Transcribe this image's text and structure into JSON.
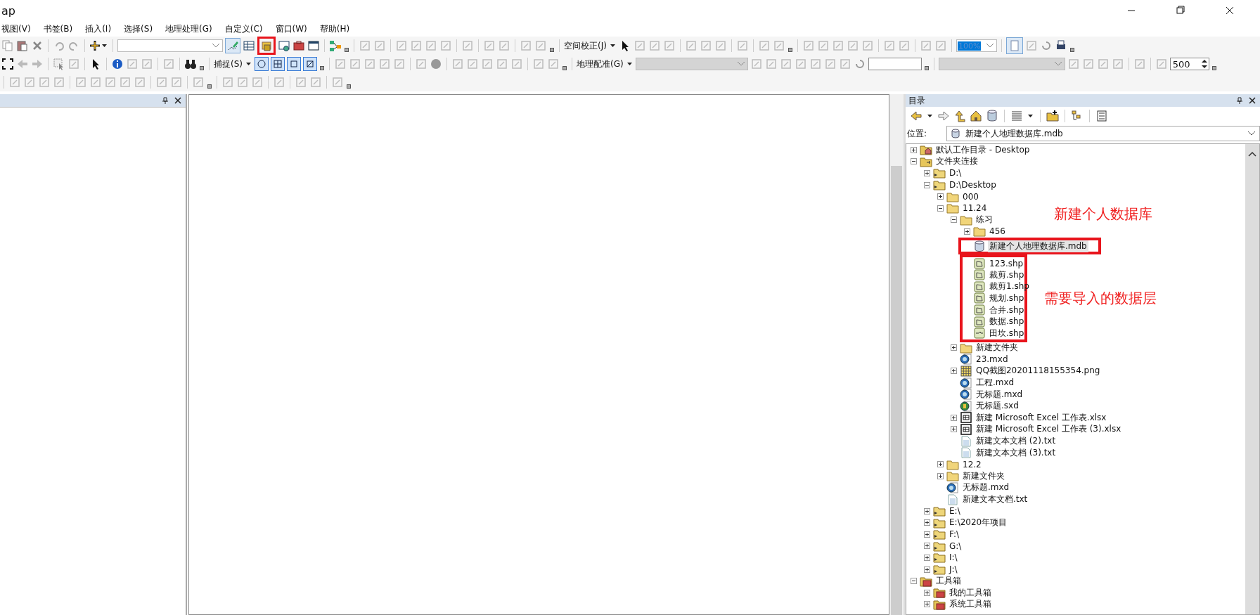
{
  "window": {
    "title": "ap"
  },
  "menu": [
    {
      "label": "视图(V)"
    },
    {
      "label": "书签(B)"
    },
    {
      "label": "插入(I)"
    },
    {
      "label": "选择(S)"
    },
    {
      "label": "地理处理(G)"
    },
    {
      "label": "自定义(C)"
    },
    {
      "label": "窗口(W)"
    },
    {
      "label": "帮助(H)"
    }
  ],
  "toolbars": {
    "catalog_button": {
      "highlighted": true
    },
    "spatial_adjustment": {
      "label": "空间校正(J)"
    },
    "layout_zoom": {
      "value": "100%"
    },
    "snapping": {
      "label": "捕捉(S)"
    },
    "georeferencing": {
      "label": "地理配准(G)"
    },
    "spinner": {
      "value": "500"
    }
  },
  "catalog": {
    "title": "目录",
    "location_label": "位置:",
    "location_value": "新建个人地理数据库.mdb",
    "tree": [
      {
        "label": "默认工作目录 - Desktop",
        "kind": "home-folder",
        "expanded": false,
        "selected": false
      },
      {
        "label": "文件夹连接",
        "kind": "connections",
        "expanded": true,
        "selected": false,
        "children": [
          {
            "label": "D:\\",
            "kind": "drive",
            "expanded": false,
            "selected": false
          },
          {
            "label": "D:\\Desktop",
            "kind": "drive",
            "expanded": true,
            "selected": false,
            "children": [
              {
                "label": "000",
                "kind": "folder",
                "expanded": false,
                "selected": false
              },
              {
                "label": "11.24",
                "kind": "folder",
                "expanded": true,
                "selected": false,
                "children": [
                  {
                    "label": "练习",
                    "kind": "folder",
                    "expanded": true,
                    "selected": false,
                    "children": [
                      {
                        "label": "456",
                        "kind": "folder",
                        "expanded": false,
                        "selected": false
                      },
                      {
                        "label": "新建个人地理数据库.mdb",
                        "kind": "mdb",
                        "selected": true,
                        "highlighted": true
                      },
                      {
                        "label": "123.shp",
                        "kind": "shp-polygon",
                        "selected": false,
                        "grouped": true
                      },
                      {
                        "label": "裁剪.shp",
                        "kind": "shp-polygon",
                        "selected": false,
                        "grouped": true
                      },
                      {
                        "label": "裁剪1.shp",
                        "kind": "shp-polygon",
                        "selected": false,
                        "grouped": true
                      },
                      {
                        "label": "规划.shp",
                        "kind": "shp-polygon",
                        "selected": false,
                        "grouped": true
                      },
                      {
                        "label": "合并.shp",
                        "kind": "shp-polygon",
                        "selected": false,
                        "grouped": true
                      },
                      {
                        "label": "数据.shp",
                        "kind": "shp-polygon",
                        "selected": false,
                        "grouped": true
                      },
                      {
                        "label": "田坎.shp",
                        "kind": "shp-line",
                        "selected": false,
                        "grouped": true
                      }
                    ]
                  },
                  {
                    "label": "新建文件夹",
                    "kind": "folder",
                    "expanded": false,
                    "selected": false
                  },
                  {
                    "label": "23.mxd",
                    "kind": "mxd",
                    "selected": false
                  },
                  {
                    "label": "QQ截图20201118155354.png",
                    "kind": "raster",
                    "expanded": false,
                    "selected": false
                  },
                  {
                    "label": "工程.mxd",
                    "kind": "mxd",
                    "selected": false
                  },
                  {
                    "label": "无标题.mxd",
                    "kind": "mxd",
                    "selected": false
                  },
                  {
                    "label": "无标题.sxd",
                    "kind": "sxd",
                    "selected": false
                  },
                  {
                    "label": "新建 Microsoft Excel 工作表.xlsx",
                    "kind": "table",
                    "expanded": false,
                    "selected": false
                  },
                  {
                    "label": "新建 Microsoft Excel 工作表 (3).xlsx",
                    "kind": "table",
                    "expanded": false,
                    "selected": false
                  },
                  {
                    "label": "新建文本文档 (2).txt",
                    "kind": "text",
                    "selected": false
                  },
                  {
                    "label": "新建文本文档 (3).txt",
                    "kind": "text",
                    "selected": false
                  }
                ]
              },
              {
                "label": "12.2",
                "kind": "folder",
                "expanded": false,
                "selected": false
              },
              {
                "label": "新建文件夹",
                "kind": "folder",
                "expanded": false,
                "selected": false
              },
              {
                "label": "无标题.mxd",
                "kind": "mxd",
                "selected": false
              },
              {
                "label": "新建文本文档.txt",
                "kind": "text",
                "selected": false
              }
            ]
          },
          {
            "label": "E:\\",
            "kind": "drive",
            "expanded": false,
            "selected": false
          },
          {
            "label": "E:\\2020年项目",
            "kind": "drive",
            "expanded": false,
            "selected": false
          },
          {
            "label": "F:\\",
            "kind": "drive",
            "expanded": false,
            "selected": false
          },
          {
            "label": "G:\\",
            "kind": "drive",
            "expanded": false,
            "selected": false
          },
          {
            "label": "I:\\",
            "kind": "drive",
            "expanded": false,
            "selected": false
          },
          {
            "label": "J:\\",
            "kind": "drive",
            "expanded": false,
            "selected": false
          }
        ]
      },
      {
        "label": "工具箱",
        "kind": "toolbox",
        "expanded": true,
        "selected": false,
        "children": [
          {
            "label": "我的工具箱",
            "kind": "toolbox",
            "expanded": false,
            "selected": false
          },
          {
            "label": "系统工具箱",
            "kind": "toolbox",
            "expanded": false,
            "selected": false
          }
        ]
      }
    ]
  },
  "annotations": [
    {
      "text": "新建个人数据库"
    },
    {
      "text": "需要导入的数据层"
    }
  ]
}
